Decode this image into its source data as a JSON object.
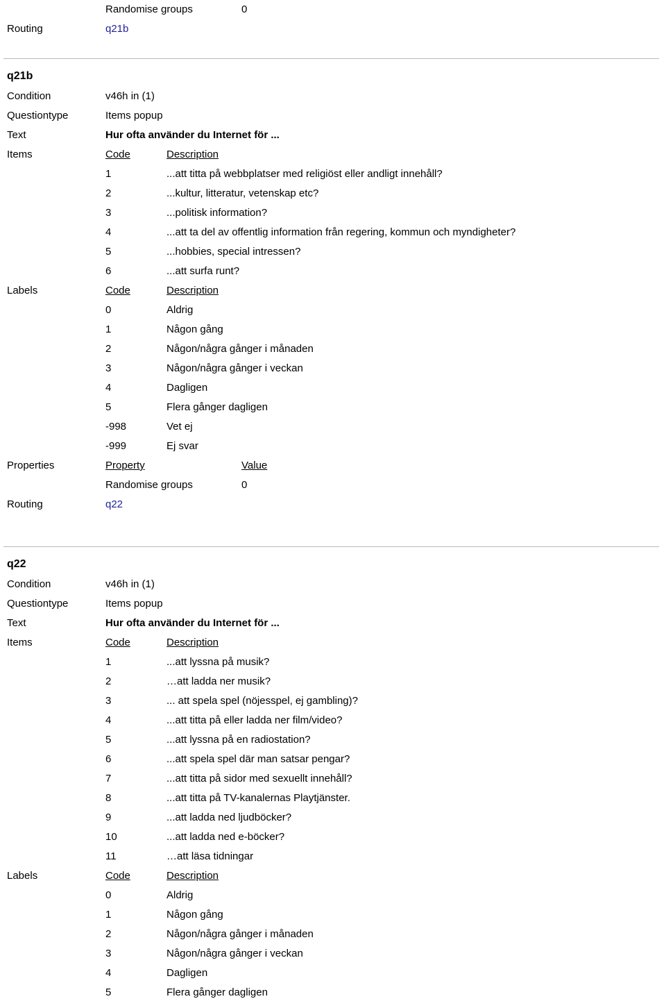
{
  "top_fragment": {
    "property_row": {
      "property": "Randomise groups",
      "value": "0"
    },
    "routing_label": "Routing",
    "routing_value": "q21b"
  },
  "common": {
    "condition_label": "Condition",
    "questiontype_label": "Questiontype",
    "text_label": "Text",
    "items_label": "Items",
    "labels_label": "Labels",
    "properties_label": "Properties",
    "routing_label": "Routing",
    "code_header": "Code",
    "description_header": "Description",
    "property_header": "Property",
    "value_header": "Value",
    "link_color": "#22229c",
    "rule_color": "#b8b8b8"
  },
  "questions": [
    {
      "id": "q21b",
      "title": "q21b",
      "condition": "v46h in (1)",
      "questiontype": "Items popup",
      "text": "Hur ofta använder du Internet för ...",
      "items": [
        {
          "code": "1",
          "description": "...att titta på webbplatser med religiöst eller andligt innehåll?"
        },
        {
          "code": "2",
          "description": "...kultur, litteratur, vetenskap etc?"
        },
        {
          "code": "3",
          "description": "...politisk information?"
        },
        {
          "code": "4",
          "description": "...att ta del av offentlig information från regering, kommun och myndigheter?"
        },
        {
          "code": "5",
          "description": "...hobbies, special intressen?"
        },
        {
          "code": "6",
          "description": "...att surfa runt?"
        }
      ],
      "labels": [
        {
          "code": "0",
          "description": "Aldrig"
        },
        {
          "code": "1",
          "description": "Någon gång"
        },
        {
          "code": "2",
          "description": "Någon/några gånger i månaden"
        },
        {
          "code": "3",
          "description": "Någon/några gånger i veckan"
        },
        {
          "code": "4",
          "description": "Dagligen"
        },
        {
          "code": "5",
          "description": "Flera gånger dagligen"
        },
        {
          "code": "-998",
          "description": "Vet ej"
        },
        {
          "code": "-999",
          "description": "Ej svar"
        }
      ],
      "properties": [
        {
          "property": "Randomise groups",
          "value": "0"
        }
      ],
      "routing": "q22"
    },
    {
      "id": "q22",
      "title": "q22",
      "condition": "v46h in (1)",
      "questiontype": "Items popup",
      "text": "Hur ofta använder du Internet för ...",
      "items": [
        {
          "code": "1",
          "description": "...att lyssna på musik?"
        },
        {
          "code": "2",
          "description": "…att ladda ner musik?"
        },
        {
          "code": "3",
          "description": "... att spela spel (nöjesspel, ej gambling)?"
        },
        {
          "code": "4",
          "description": "...att titta på eller ladda ner film/video?"
        },
        {
          "code": "5",
          "description": "...att lyssna på en radiostation?"
        },
        {
          "code": "6",
          "description": "...att spela spel där man satsar pengar?"
        },
        {
          "code": "7",
          "description": "...att titta på sidor med sexuellt innehåll?"
        },
        {
          "code": "8",
          "description": "...att titta på TV-kanalernas Playtjänster."
        },
        {
          "code": "9",
          "description": "...att ladda ned ljudböcker?"
        },
        {
          "code": "10",
          "description": "...att ladda ned e-böcker?"
        },
        {
          "code": "11",
          "description": "…att läsa tidningar"
        }
      ],
      "labels": [
        {
          "code": "0",
          "description": "Aldrig"
        },
        {
          "code": "1",
          "description": "Någon gång"
        },
        {
          "code": "2",
          "description": "Någon/några gånger i månaden"
        },
        {
          "code": "3",
          "description": "Någon/några gånger i veckan"
        },
        {
          "code": "4",
          "description": "Dagligen"
        },
        {
          "code": "5",
          "description": "Flera gånger dagligen"
        }
      ]
    }
  ]
}
